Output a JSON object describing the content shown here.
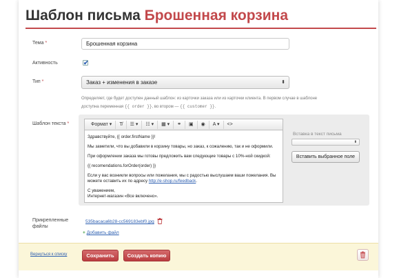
{
  "header": {
    "title_prefix": "Шаблон письма",
    "title_accent": "Брошенная корзина"
  },
  "form": {
    "subject": {
      "label": "Тема",
      "value": "Брошенная корзина"
    },
    "active": {
      "label": "Активность",
      "checked": true
    },
    "type": {
      "label": "Тип",
      "selected": "Заказ + изменения в заказе",
      "help_line1": "Определяет, где будет доступен данный шаблон: из карточки заказа или из карточки клиента. В первом случае в шаблоне",
      "help_line2_prefix": "доступна переменная",
      "help_var_order": "{{ order }}",
      "help_line2_mid": ", во втором —",
      "help_var_customer": "{{ customer }}",
      "help_line2_end": "."
    },
    "template": {
      "label": "Шаблон текста",
      "toolbar": {
        "format": "Формат ▾",
        "clear": "T̸",
        "bullets": "☰ ▾",
        "numbers": "☷ ▾",
        "table": "▦ ▾",
        "link": "⚭",
        "image": "▣",
        "video": "◉",
        "color": "A ▾",
        "source": "<>"
      },
      "body": {
        "greeting": "Здравствуйте, {{ order.firstName }}!",
        "p1": "Мы заметили, что вы добавили в корзину товары, но заказ, к сожалению, так и не оформили.",
        "p2": "При оформлении заказа мы готовы предложить вам следующие товары с 10%-ной скидкой:",
        "p3": "{{ recomendations.forOrder(order) }}",
        "p4_line1": "Если у вас возникли вопросы или пожелания, мы с радостью выслушаем ваши пожелания. Вы",
        "p4_line2_prefix": "можете оставить их по адресу",
        "p4_link": "http://e-shop.ru/feedback",
        "p4_line2_end": ".",
        "sign1": "С уважением,",
        "sign2": "Интернет-магазин «Все включено»."
      },
      "insert": {
        "label": "Вставка в текст письма",
        "select_value": "",
        "button": "Вставить выбранное поле"
      }
    },
    "files": {
      "label_line1": "Прикрепленные",
      "label_line2": "файлы",
      "file_name": "535bacaca6b28-cc569183ebf0.jpg",
      "add_file": "Добавить файл"
    }
  },
  "footer": {
    "back": "Вернуться к списку",
    "save": "Сохранить",
    "copy": "Создать копию"
  },
  "colors": {
    "accent": "#c2484b",
    "link": "#2a5db0",
    "footer_bg": "#fbf6d9"
  }
}
